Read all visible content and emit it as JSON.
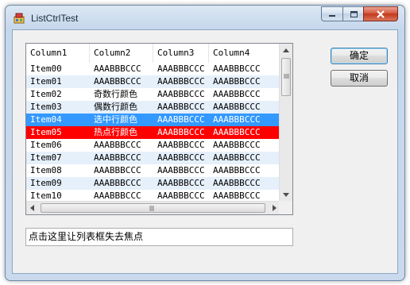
{
  "window": {
    "title": "ListCtrlTest"
  },
  "list": {
    "columns": [
      "Column1",
      "Column2",
      "Column3",
      "Column4"
    ],
    "rows": [
      {
        "c": [
          "Item00",
          "AAABBBCCC",
          "AAABBBCCC",
          "AAABBBCCC"
        ],
        "style": "normal"
      },
      {
        "c": [
          "Item01",
          "AAABBBCCC",
          "AAABBBCCC",
          "AAABBBCCC"
        ],
        "style": "alt"
      },
      {
        "c": [
          "Item02",
          "奇数行颜色",
          "AAABBBCCC",
          "AAABBBCCC"
        ],
        "style": "normal"
      },
      {
        "c": [
          "Item03",
          "偶数行颜色",
          "AAABBBCCC",
          "AAABBBCCC"
        ],
        "style": "alt"
      },
      {
        "c": [
          "Item04",
          "选中行颜色",
          "AAABBBCCC",
          "AAABBBCCC"
        ],
        "style": "selected"
      },
      {
        "c": [
          "Item05",
          "热点行颜色",
          "AAABBBCCC",
          "AAABBBCCC"
        ],
        "style": "hot"
      },
      {
        "c": [
          "Item06",
          "AAABBBCCC",
          "AAABBBCCC",
          "AAABBBCCC"
        ],
        "style": "normal"
      },
      {
        "c": [
          "Item07",
          "AAABBBCCC",
          "AAABBBCCC",
          "AAABBBCCC"
        ],
        "style": "alt"
      },
      {
        "c": [
          "Item08",
          "AAABBBCCC",
          "AAABBBCCC",
          "AAABBBCCC"
        ],
        "style": "normal"
      },
      {
        "c": [
          "Item09",
          "AAABBBCCC",
          "AAABBBCCC",
          "AAABBBCCC"
        ],
        "style": "alt"
      },
      {
        "c": [
          "Item10",
          "AAABBBCCC",
          "AAABBBCCC",
          "AAABBBCCC"
        ],
        "style": "normal"
      }
    ],
    "colors": {
      "normal_bg": "#ffffff",
      "alt_bg": "#e6f0fb",
      "selected_bg": "#3399ff",
      "selected_fg": "#ffffff",
      "hot_bg": "#ff0000",
      "hot_fg": "#ffffff",
      "text": "#000000"
    }
  },
  "buttons": {
    "ok": "确定",
    "cancel": "取消"
  },
  "focus_field": {
    "value": "点击这里让列表框失去焦点"
  },
  "icons": {
    "app": "app-icon",
    "minimize": "minimize-icon",
    "maximize": "maximize-icon",
    "close": "close-icon",
    "scroll_up": "arrow-up-icon",
    "scroll_down": "arrow-down-icon",
    "scroll_left": "arrow-left-icon",
    "scroll_right": "arrow-right-icon"
  }
}
